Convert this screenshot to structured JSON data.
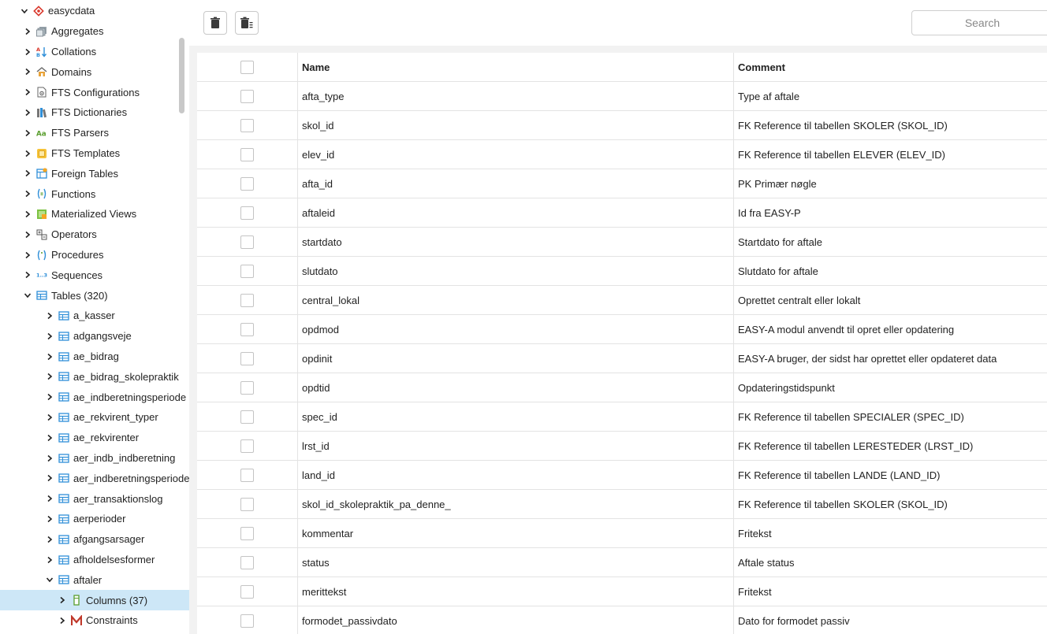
{
  "sidebar": {
    "root": {
      "label": "easycdata",
      "icon": "database-icon"
    },
    "items": [
      {
        "label": "Aggregates",
        "icon": "aggregates-icon"
      },
      {
        "label": "Collations",
        "icon": "collations-icon"
      },
      {
        "label": "Domains",
        "icon": "domains-icon"
      },
      {
        "label": "FTS Configurations",
        "icon": "fts-configurations-icon"
      },
      {
        "label": "FTS Dictionaries",
        "icon": "fts-dictionaries-icon"
      },
      {
        "label": "FTS Parsers",
        "icon": "fts-parsers-icon"
      },
      {
        "label": "FTS Templates",
        "icon": "fts-templates-icon"
      },
      {
        "label": "Foreign Tables",
        "icon": "foreign-tables-icon"
      },
      {
        "label": "Functions",
        "icon": "functions-icon"
      },
      {
        "label": "Materialized Views",
        "icon": "materialized-views-icon"
      },
      {
        "label": "Operators",
        "icon": "operators-icon"
      },
      {
        "label": "Procedures",
        "icon": "procedures-icon"
      },
      {
        "label": "Sequences",
        "icon": "sequences-icon"
      }
    ],
    "tables": {
      "label": "Tables (320)",
      "icon": "tables-icon"
    },
    "table_items": [
      "a_kasser",
      "adgangsveje",
      "ae_bidrag",
      "ae_bidrag_skolepraktik",
      "ae_indberetningsperiode",
      "ae_rekvirent_typer",
      "ae_rekvirenter",
      "aer_indb_indberetning",
      "aer_indberetningsperiode",
      "aer_transaktionslog",
      "aerperioder",
      "afgangsarsager",
      "afholdelsesformer"
    ],
    "expanded_table": "aftaler",
    "columns_node": {
      "label": "Columns (37)",
      "icon": "columns-icon"
    },
    "constraints_node": {
      "label": "Constraints",
      "icon": "constraints-icon"
    },
    "icon_color_table": "#2f8fd8"
  },
  "toolbar": {
    "delete_icon": "trash-icon",
    "delete_cascade_icon": "trash-cascade-icon",
    "search_placeholder": "Search"
  },
  "grid": {
    "headers": {
      "name": "Name",
      "comment": "Comment"
    },
    "rows": [
      {
        "name": "afta_type",
        "comment": "Type af aftale"
      },
      {
        "name": "skol_id",
        "comment": "FK Reference til tabellen SKOLER (SKOL_ID)"
      },
      {
        "name": "elev_id",
        "comment": "FK Reference til tabellen ELEVER (ELEV_ID)"
      },
      {
        "name": "afta_id",
        "comment": "PK Primær nøgle"
      },
      {
        "name": "aftaleid",
        "comment": "Id fra EASY-P"
      },
      {
        "name": "startdato",
        "comment": "Startdato for aftale"
      },
      {
        "name": "slutdato",
        "comment": "Slutdato for aftale"
      },
      {
        "name": "central_lokal",
        "comment": "Oprettet centralt eller lokalt"
      },
      {
        "name": "opdmod",
        "comment": "EASY-A modul anvendt til opret eller opdatering"
      },
      {
        "name": "opdinit",
        "comment": "EASY-A bruger, der sidst har oprettet eller opdateret data"
      },
      {
        "name": "opdtid",
        "comment": "Opdateringstidspunkt"
      },
      {
        "name": "spec_id",
        "comment": "FK Reference til tabellen SPECIALER (SPEC_ID)"
      },
      {
        "name": "lrst_id",
        "comment": "FK Reference til tabellen LERESTEDER (LRST_ID)"
      },
      {
        "name": "land_id",
        "comment": "FK Reference til tabellen LANDE (LAND_ID)"
      },
      {
        "name": "skol_id_skolepraktik_pa_denne_",
        "comment": "FK Reference til tabellen SKOLER (SKOL_ID)"
      },
      {
        "name": "kommentar",
        "comment": "Fritekst"
      },
      {
        "name": "status",
        "comment": "Aftale status"
      },
      {
        "name": "merittekst",
        "comment": "Fritekst"
      },
      {
        "name": "formodet_passivdato",
        "comment": "Dato for formodet passiv"
      }
    ]
  }
}
